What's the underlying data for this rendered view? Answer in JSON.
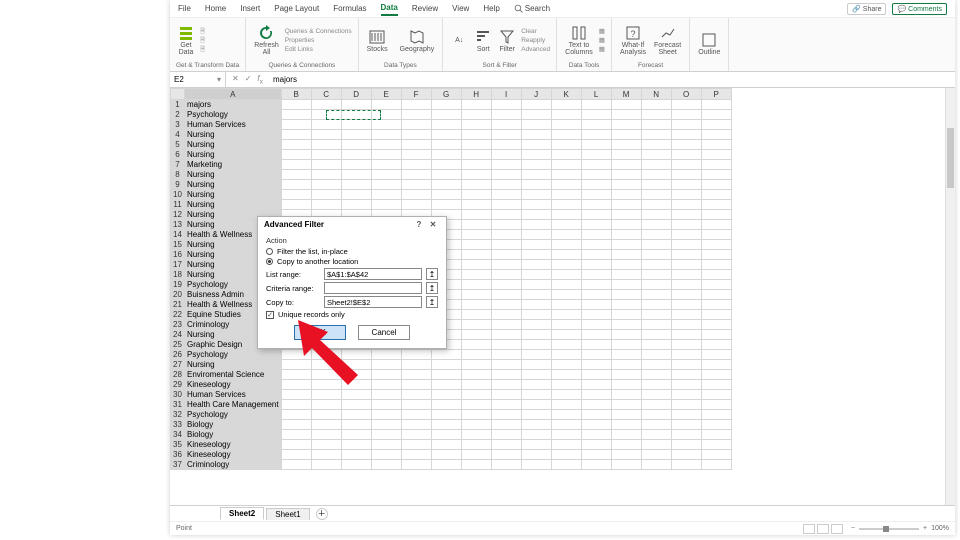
{
  "menubar": {
    "tabs": [
      "File",
      "Home",
      "Insert",
      "Page Layout",
      "Formulas",
      "Data",
      "Review",
      "View",
      "Help"
    ],
    "active_index": 5,
    "search_label": "Search",
    "share_label": "Share",
    "comments_label": "Comments"
  },
  "ribbon_groups": {
    "getdata": {
      "label": "Get & Transform Data",
      "btn": "Get\nData"
    },
    "queries": {
      "label": "Queries & Connections",
      "btn": "Refresh\nAll",
      "items": [
        "Queries & Connections",
        "Properties",
        "Edit Links"
      ]
    },
    "datatypes": {
      "label": "Data Types",
      "b1": "Stocks",
      "b2": "Geography"
    },
    "sortfilter": {
      "label": "Sort & Filter",
      "b1": "Sort",
      "b2": "Filter",
      "items": [
        "Clear",
        "Reapply",
        "Advanced"
      ]
    },
    "datatools": {
      "label": "Data Tools",
      "btn": "Text to\nColumns"
    },
    "forecast": {
      "label": "Forecast",
      "b1": "What-If\nAnalysis",
      "b2": "Forecast\nSheet"
    },
    "outline": {
      "label": "",
      "btn": "Outline"
    }
  },
  "fx": {
    "cell": "E2",
    "formula": "majors"
  },
  "columns": [
    "A",
    "B",
    "C",
    "D",
    "E",
    "F",
    "G",
    "H",
    "I",
    "J",
    "K",
    "L",
    "M",
    "N",
    "O",
    "P"
  ],
  "colA_data": [
    "majors",
    "Psychology",
    "Human Services",
    "Nursing",
    "Nursing",
    "Nursing",
    "Marketing",
    "Nursing",
    "Nursing",
    "Nursing",
    "Nursing",
    "Nursing",
    "Nursing",
    "Health & Wellness",
    "Nursing",
    "Nursing",
    "Nursing",
    "Nursing",
    "Psychology",
    "Buisness Admin",
    "Health & Wellness",
    "Equine Studies",
    "Criminology",
    "Nursing",
    "Graphic Design",
    "Psychology",
    "Nursing",
    "Enviromental Science",
    "Kineseology",
    "Human Services",
    "Health Care Management",
    "Psychology",
    "Biology",
    "Biology",
    "Kineseology",
    "Kineseology",
    "Criminology"
  ],
  "dialog": {
    "title": "Advanced Filter",
    "action_label": "Action",
    "radio1": "Filter the list, in-place",
    "radio2": "Copy to another location",
    "field1": "List range:",
    "val1": "$A$1:$A$42",
    "field2": "Criteria range:",
    "val2": "",
    "field3": "Copy to:",
    "val3": "Sheet2!$E$2",
    "chk": "Unique records only",
    "ok": "OK",
    "cancel": "Cancel"
  },
  "sheets": {
    "tabs": [
      "Sheet2",
      "Sheet1"
    ],
    "active": 0
  },
  "status": {
    "mode": "Point",
    "zoom": "100%"
  },
  "annotation": {
    "arrow_target": "ok-button"
  }
}
